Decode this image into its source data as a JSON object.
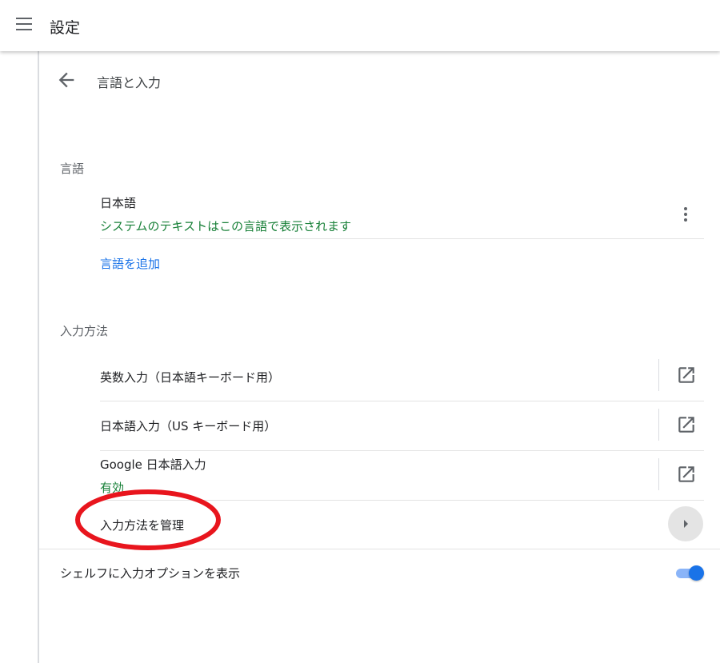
{
  "header": {
    "title": "設定",
    "menu_icon": "hamburger-menu-icon"
  },
  "subpage": {
    "title": "言語と入力",
    "back_icon": "arrow-back-icon"
  },
  "languages": {
    "section_label": "言語",
    "items": [
      {
        "name": "日本語",
        "description": "システムのテキストはこの言語で表示されます",
        "menu_icon": "more-vert-icon"
      }
    ],
    "add_link": "言語を追加"
  },
  "input_methods": {
    "section_label": "入力方法",
    "items": [
      {
        "label": "英数入力（日本語キーボード用）",
        "status": "",
        "action_icon": "open-in-new-icon"
      },
      {
        "label": "日本語入力（US キーボード用）",
        "status": "",
        "action_icon": "open-in-new-icon"
      },
      {
        "label": "Google 日本語入力",
        "status": "有効",
        "action_icon": "open-in-new-icon"
      }
    ],
    "manage_label": "入力方法を管理",
    "manage_icon": "arrow-right-icon"
  },
  "shelf_option": {
    "label": "シェルフに入力オプションを表示",
    "enabled": true
  },
  "colors": {
    "accent": "#1a73e8",
    "status_green": "#188038",
    "annotation_red": "#e8151d"
  }
}
